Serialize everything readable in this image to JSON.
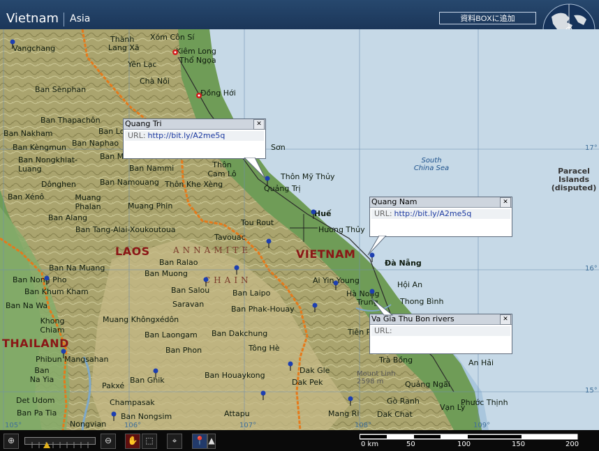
{
  "header": {
    "title": "Vietnam",
    "subtitle": "Asia",
    "add_box_button": "資料BOXに追加"
  },
  "map": {
    "countries": {
      "laos": "LAOS",
      "vietnam": "VIETNAM",
      "thailand": "THAILAND"
    },
    "regions": {
      "annamite": "ANNAMITE",
      "chain": "CHAIN"
    },
    "sea": "South China Sea",
    "islands": "Paracel Islands (disputed)",
    "elevation": {
      "name": "Mount Linh",
      "value": "2598 m"
    },
    "grid_labels": {
      "lat17": "17°",
      "lat16": "16°",
      "lat15": "15°",
      "lon105": "105°",
      "lon106": "106°",
      "lon107": "107°",
      "lon108": "108°",
      "lon109": "109°"
    },
    "places": {
      "vangchang": "Vangchang",
      "thanh": "Thành",
      "lang_xa": "Lang Xã",
      "xom_con_si": "Xóm Côn Sí",
      "kiem_long": "Kiêm Long",
      "tho_ngoa": "Thổ Ngọa",
      "yen_lac": "Yên Lạc",
      "cha_noi": "Chà Nôi",
      "dong_hoi": "Đồng Hới",
      "ban_senphan": "Ban Sènphan",
      "ban_thapachon": "Ban Thapachôn",
      "ban_nakham": "Ban Nakham",
      "ban_lo": "Ban Lo",
      "ban_kengmun": "Ban Kèngmun",
      "ban_naphao": "Ban Naphao",
      "ban_m": "Ban M",
      "son": "Sơn",
      "ban_nongkhiat": "Ban Nongkhiat-Luang",
      "ban_nammi": "Ban Nammi",
      "thon_cam_lo": "Thôn Cam Lô",
      "thon_my_thuy": "Thôn Mỹ Thủy",
      "donghen": "Dônghen",
      "ban_namouang": "Ban Namouang",
      "thon_khe_xeng": "Thôn Khe Xèng",
      "quang_tri": "Quảng Trị",
      "ban_xeno": "Ban Xénô",
      "muang_phalan": "Muang Phalan",
      "muang_phin": "Muang Phin",
      "hue": "Huế",
      "ban_alang": "Ban Alang",
      "tou_rout": "Tou Rout",
      "huong_thuy": "Hương Thủy",
      "ban_tang_alai": "Ban Tang-Alai-Xoukoutoua",
      "tavouac": "Tavouac",
      "ban_ralao": "Ban Ralao",
      "ban_na_muang": "Ban Na Muang",
      "ban_muong": "Ban Muong",
      "da_nang": "Đà Nẵng",
      "ban_nong_pho": "Ban Nong Pho",
      "ban_salou": "Ban Salou",
      "ban_laipo": "Ban Laipo",
      "ai_yin_young": "Ai Yin Young",
      "hoi_an": "Hội An",
      "ban_khum_kham": "Ban Khum Kham",
      "ha_nong": "Hà Nong",
      "thon_binh": "Thong Bình",
      "ban_na_wa": "Ban Na Wa",
      "saravan": "Saravan",
      "ban_phak_houay": "Ban Phak-Houay",
      "trung": "Trung",
      "khong_chiam": "Khong Chiam",
      "muang_khongxedon": "Muang Khôngxédôn",
      "tien_ph": "Tiên Ph",
      "ban_laongam": "Ban Laongam",
      "ban_dakchung": "Ban Dakchung",
      "tong_he": "Tông Hè",
      "ban_phon": "Ban Phon",
      "phibun_mangsahan": "Phibun Mangsahan",
      "tra_bong": "Trà Bồng",
      "an_hai": "An Hải",
      "ban_na_yia": "Ban Na Yia",
      "ban_ghik": "Ban Ghik",
      "ban_houaykong": "Ban Houaykong",
      "dak_gle": "Dak Gle",
      "dak_pec": "Dak Pek",
      "quang_ngai": "Quảng Ngãi",
      "pakxe": "Pakxé",
      "det_udom": "Det Udom",
      "champasak": "Champasak",
      "goranh": "Gò Ranh",
      "van_ly": "Vạn Lý",
      "phuoc_thinh": "Phước Thịnh",
      "ban_pa_tia": "Ban Pa Tia",
      "ban_nongsim": "Ban Nongsim",
      "attapu": "Attapu",
      "mang_ri": "Mang Ri",
      "dak_chat": "Dak Chat",
      "nongvian": "Nongvian"
    },
    "popups": [
      {
        "title": "Quang Tri",
        "url_label": "URL:",
        "url": "http://bit.ly/A2me5q"
      },
      {
        "title": "Quang Nam",
        "url_label": "URL:",
        "url": "http://bit.ly/A2me5q"
      },
      {
        "title": "Va Gia Thu Bon rivers",
        "url_label": "URL:",
        "url": ""
      }
    ]
  },
  "scale": {
    "labels": [
      "0 km",
      "50",
      "100",
      "150",
      "200"
    ]
  },
  "colors": {
    "sea": "#a9c6dd",
    "deep_sea": "#c6d9e7",
    "lowland": "#6f9c57",
    "upland": "#b9ae79",
    "border": "#e57a1b",
    "header": "#1f3e64"
  }
}
